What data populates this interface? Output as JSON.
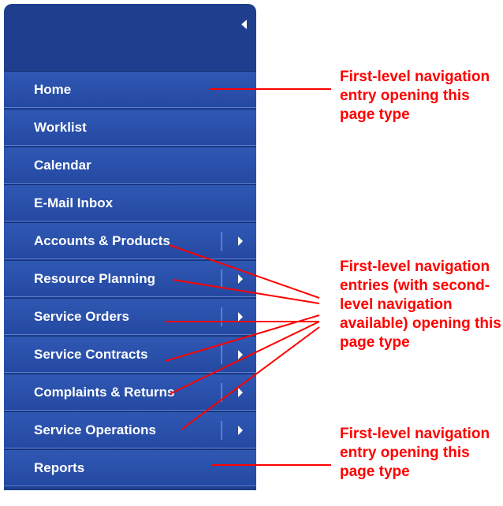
{
  "nav": {
    "items": [
      {
        "label": "Home",
        "has_submenu": false
      },
      {
        "label": "Worklist",
        "has_submenu": false
      },
      {
        "label": "Calendar",
        "has_submenu": false
      },
      {
        "label": "E-Mail Inbox",
        "has_submenu": false
      },
      {
        "label": "Accounts & Products",
        "has_submenu": true
      },
      {
        "label": "Resource Planning",
        "has_submenu": true
      },
      {
        "label": "Service Orders",
        "has_submenu": true
      },
      {
        "label": "Service Contracts",
        "has_submenu": true
      },
      {
        "label": "Complaints & Returns",
        "has_submenu": true
      },
      {
        "label": "Service Operations",
        "has_submenu": true
      },
      {
        "label": "Reports",
        "has_submenu": false
      }
    ]
  },
  "annotations": {
    "top": "First-level navigation entry opening this page type",
    "middle": "First-level navigation entries (with second-level navigation available) opening this page type",
    "bottom": "First-level navigation entry opening this page type"
  },
  "colors": {
    "nav_bg": "#2549a2",
    "annotation": "#ff0000"
  }
}
